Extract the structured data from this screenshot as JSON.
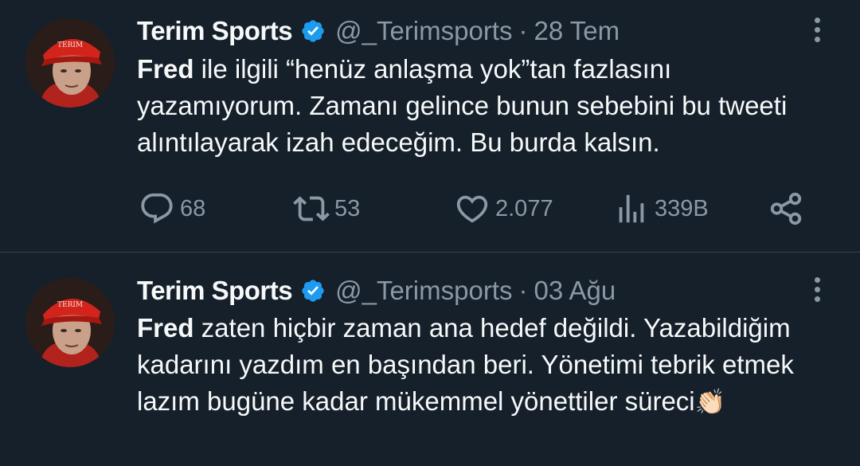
{
  "tweets": [
    {
      "name": "Terim Sports",
      "handle": "@_Terimsports",
      "separator": "·",
      "date": "28 Tem",
      "text_bold": "Fred",
      "text_rest": " ile ilgili “henüz anlaşma yok”tan fazlasını yazamıyorum. Zamanı gelince bunun sebebini bu tweeti alıntılayarak izah edeceğim. Bu burda kalsın.",
      "stats": {
        "replies": "68",
        "retweets": "53",
        "likes": "2.077",
        "views": "339B"
      }
    },
    {
      "name": "Terim Sports",
      "handle": "@_Terimsports",
      "separator": "·",
      "date": "03 Ağu",
      "text_bold": "Fred",
      "text_rest": " zaten hiçbir zaman ana hedef değildi. Yazabildiğim kadarını yazdım en başından beri. Yönetimi tebrik etmek lazım bugüne kadar mükemmel yönettiler süreci",
      "emoji": "👏🏻"
    }
  ],
  "colors": {
    "background": "#15202b",
    "text": "#f7f9f9",
    "muted": "#8b98a5",
    "verified": "#1d9bf0",
    "divider": "#38444d"
  },
  "icons": [
    "verified-badge-icon",
    "more-options-icon",
    "reply-icon",
    "retweet-icon",
    "like-icon",
    "views-icon",
    "share-icon"
  ]
}
